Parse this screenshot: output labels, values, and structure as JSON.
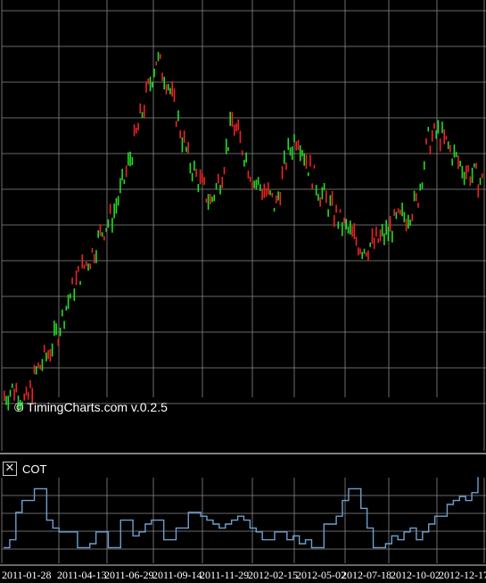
{
  "watermark": "© TimingCharts.com v.0.2.5",
  "indicator": {
    "label": "COT",
    "close_icon": "close-icon"
  },
  "colors": {
    "background": "#000000",
    "grid": "#8a8a8a",
    "up": "#22dd22",
    "down": "#ee2222",
    "cot_line": "#6e9fd0"
  },
  "chart_data": [
    {
      "type": "candlestick",
      "title": "",
      "grid": true,
      "x_tick_labels": [
        "2011-01-28",
        "2011-04-13",
        "2011-06-29",
        "2011-09-14",
        "2011-11-29",
        "2012-02-15",
        "2012-05-02",
        "2012-07-18",
        "2012-10-02",
        "2012-12-17"
      ],
      "ylim": [
        0,
        100
      ],
      "note_scale": "price axis unlabeled; values in relative units 0-100",
      "path": [
        {
          "t": 0,
          "v": 8
        },
        {
          "t": 4,
          "v": 10
        },
        {
          "t": 8,
          "v": 6
        },
        {
          "t": 12,
          "v": 14
        },
        {
          "t": 16,
          "v": 18
        },
        {
          "t": 20,
          "v": 24
        },
        {
          "t": 24,
          "v": 32
        },
        {
          "t": 28,
          "v": 38
        },
        {
          "t": 32,
          "v": 42
        },
        {
          "t": 36,
          "v": 48
        },
        {
          "t": 40,
          "v": 52
        },
        {
          "t": 44,
          "v": 60
        },
        {
          "t": 48,
          "v": 70
        },
        {
          "t": 52,
          "v": 80
        },
        {
          "t": 56,
          "v": 90
        },
        {
          "t": 60,
          "v": 85
        },
        {
          "t": 64,
          "v": 75
        },
        {
          "t": 68,
          "v": 65
        },
        {
          "t": 72,
          "v": 60
        },
        {
          "t": 76,
          "v": 55
        },
        {
          "t": 80,
          "v": 62
        },
        {
          "t": 84,
          "v": 75
        },
        {
          "t": 88,
          "v": 68
        },
        {
          "t": 92,
          "v": 60
        },
        {
          "t": 96,
          "v": 58
        },
        {
          "t": 100,
          "v": 54
        },
        {
          "t": 104,
          "v": 66
        },
        {
          "t": 108,
          "v": 72
        },
        {
          "t": 112,
          "v": 64
        },
        {
          "t": 116,
          "v": 58
        },
        {
          "t": 120,
          "v": 54
        },
        {
          "t": 124,
          "v": 50
        },
        {
          "t": 128,
          "v": 47
        },
        {
          "t": 132,
          "v": 44
        },
        {
          "t": 136,
          "v": 45
        },
        {
          "t": 140,
          "v": 47
        },
        {
          "t": 144,
          "v": 50
        },
        {
          "t": 148,
          "v": 52
        },
        {
          "t": 152,
          "v": 55
        },
        {
          "t": 156,
          "v": 70
        },
        {
          "t": 160,
          "v": 72
        },
        {
          "t": 164,
          "v": 68
        },
        {
          "t": 168,
          "v": 64
        },
        {
          "t": 172,
          "v": 62
        },
        {
          "t": 176,
          "v": 60
        }
      ]
    },
    {
      "type": "line",
      "title": "COT",
      "grid": true,
      "ylim": [
        0,
        100
      ],
      "series": [
        {
          "values": [
            20,
            30,
            65,
            80,
            80,
            95,
            95,
            55,
            45,
            40,
            40,
            40,
            20,
            20,
            25,
            40,
            40,
            20,
            20,
            55,
            55,
            35,
            40,
            50,
            55,
            55,
            30,
            30,
            45,
            45,
            65,
            65,
            60,
            55,
            50,
            45,
            50,
            55,
            60,
            55,
            45,
            40,
            30,
            30,
            40,
            40,
            30,
            35,
            25,
            30,
            20,
            20,
            50,
            50,
            60,
            80,
            95,
            95,
            70,
            45,
            20,
            20,
            25,
            35,
            30,
            40,
            45,
            30,
            40,
            50,
            60,
            60,
            75,
            80,
            85,
            80,
            90,
            110
          ]
        }
      ]
    }
  ]
}
